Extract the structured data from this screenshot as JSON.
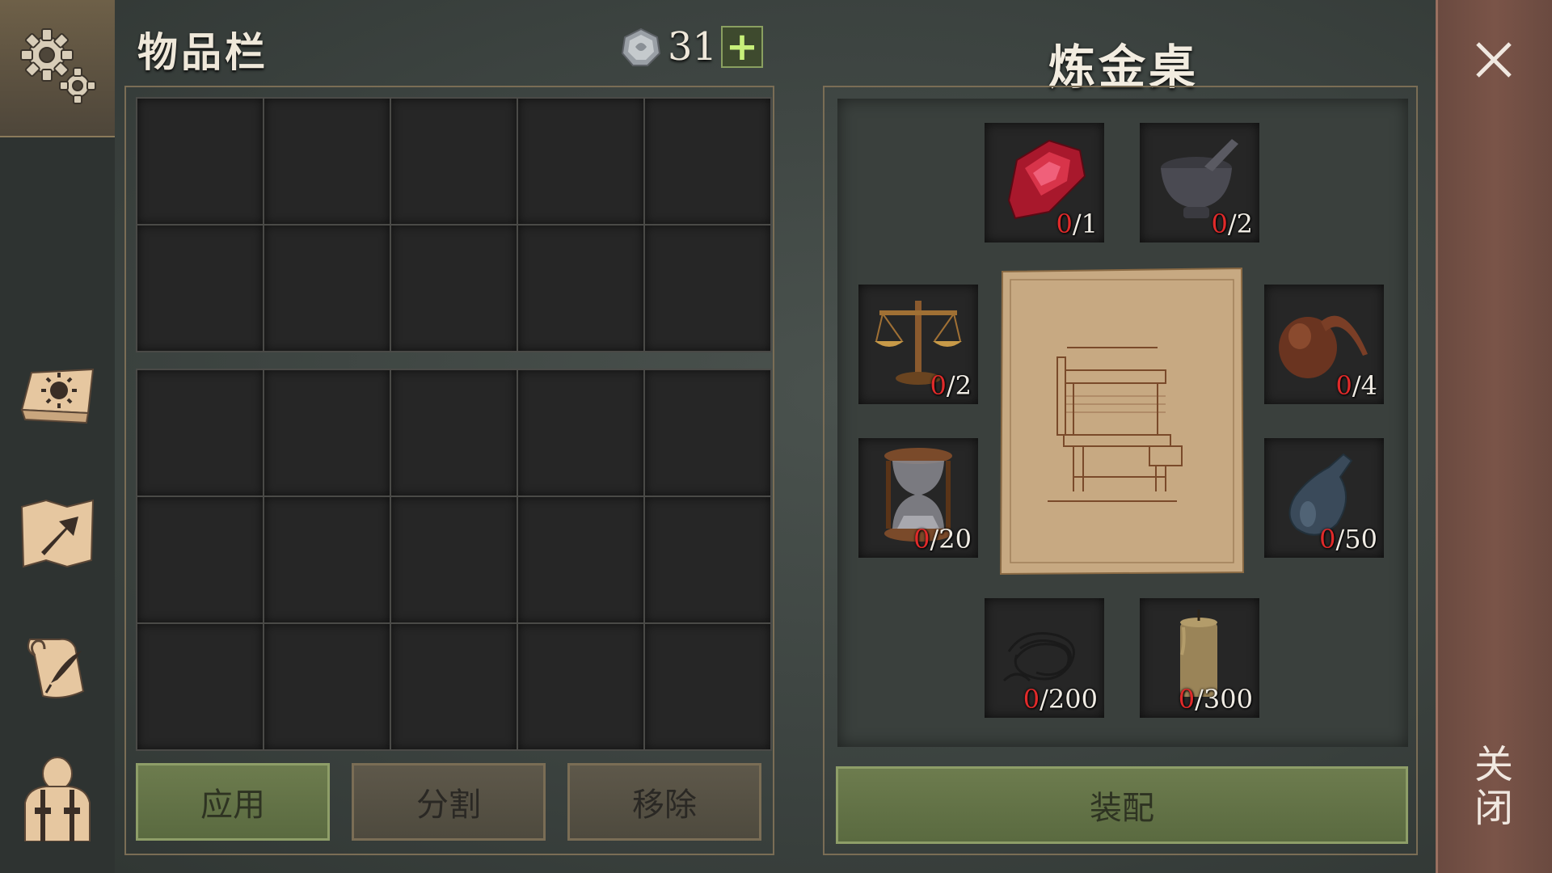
{
  "sidebar": {
    "settings_icon": "gear-icon",
    "items": [
      {
        "name": "journal",
        "icon": "sun-book-icon"
      },
      {
        "name": "map",
        "icon": "map-arrow-icon"
      },
      {
        "name": "recipes",
        "icon": "scroll-quill-icon"
      },
      {
        "name": "character",
        "icon": "character-icon"
      }
    ]
  },
  "inventory": {
    "title": "物品栏",
    "coins": "31",
    "add_label": "+",
    "top_slots": 10,
    "bottom_slots": 15,
    "buttons": {
      "apply": "应用",
      "split": "分割",
      "remove": "移除"
    }
  },
  "alchemy": {
    "title": "炼金桌",
    "ingredients": [
      {
        "name": "ruby",
        "icon": "ruby-icon",
        "have": "0",
        "need": "/1"
      },
      {
        "name": "mortar",
        "icon": "mortar-icon",
        "have": "0",
        "need": "/2"
      },
      {
        "name": "scales",
        "icon": "scales-icon",
        "have": "0",
        "need": "/2"
      },
      {
        "name": "retort",
        "icon": "retort-icon",
        "have": "0",
        "need": "/4"
      },
      {
        "name": "hourglass",
        "icon": "hourglass-icon",
        "have": "0",
        "need": "/20"
      },
      {
        "name": "flask",
        "icon": "flask-icon",
        "have": "0",
        "need": "/50"
      },
      {
        "name": "wire",
        "icon": "wire-icon",
        "have": "0",
        "need": "/200"
      },
      {
        "name": "candle",
        "icon": "candle-icon",
        "have": "0",
        "need": "/300"
      }
    ],
    "assemble_label": "装配"
  },
  "close": {
    "label": "关闭"
  },
  "colors": {
    "accent_green": "#6d7c4e",
    "count_red": "#e02a2a",
    "close_strip": "#7a5448"
  }
}
